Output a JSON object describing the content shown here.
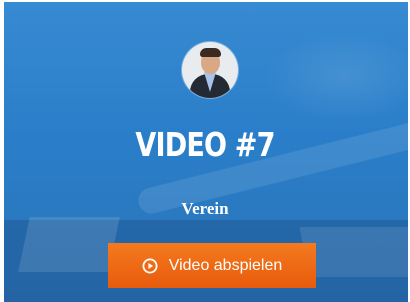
{
  "hero": {
    "title": "VIDEO #7",
    "subtitle": "Verein",
    "avatar_icon": "person-portrait-icon",
    "background_color": "#2a7ec9"
  },
  "cta": {
    "label": "Video abspielen",
    "icon": "play-circle-icon",
    "color": "#ef6a15"
  }
}
